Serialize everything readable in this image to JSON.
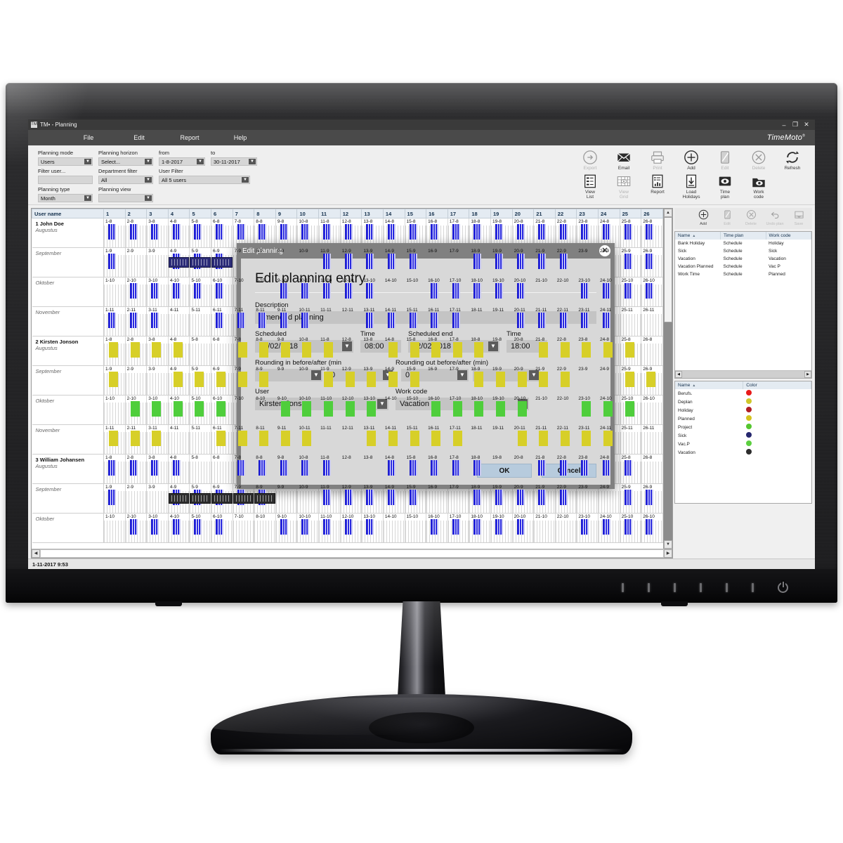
{
  "window": {
    "title": "TM• - Planning",
    "app_icon": "TM",
    "minimize": "–",
    "maximize": "❐",
    "close": "✕",
    "brand": "TimeMoto",
    "brand_mark": "®"
  },
  "menubar": {
    "items": [
      "File",
      "Edit",
      "Report",
      "Help"
    ]
  },
  "filters": {
    "planning_mode": {
      "label": "Planning mode",
      "value": "Users"
    },
    "planning_horizon": {
      "label": "Planning horizon",
      "value": "Select..."
    },
    "from": {
      "label": "from",
      "value": "1-8-2017"
    },
    "to": {
      "label": "to",
      "value": "30-11-2017"
    },
    "filter_user": {
      "label": "Filter user...",
      "value": ""
    },
    "department_filter": {
      "label": "Department filter",
      "value": "All"
    },
    "user_filter": {
      "label": "User Filter",
      "value": "All 5 users"
    },
    "planning_type": {
      "label": "Planning type",
      "value": "Month"
    },
    "planning_view": {
      "label": "Planning view",
      "value": ""
    }
  },
  "toolbar": {
    "row1": [
      {
        "label": "Export",
        "icon": "export-icon",
        "disabled": true
      },
      {
        "label": "Email",
        "icon": "email-icon",
        "disabled": false
      },
      {
        "label": "Print",
        "icon": "print-icon",
        "disabled": true
      },
      {
        "label": "Add",
        "icon": "add-icon",
        "disabled": false
      },
      {
        "label": "Edit",
        "icon": "edit-icon",
        "disabled": true
      },
      {
        "label": "Delete",
        "icon": "delete-icon",
        "disabled": true
      },
      {
        "label": "Refresh",
        "icon": "refresh-icon",
        "disabled": false
      }
    ],
    "row2": [
      {
        "label": "View List",
        "icon": "view-list-icon",
        "disabled": false
      },
      {
        "label": "View Grid",
        "icon": "view-grid-icon",
        "disabled": true
      },
      {
        "label": "Report",
        "icon": "report-icon",
        "disabled": false
      },
      {
        "label": "Load Holidays",
        "icon": "load-holidays-icon",
        "disabled": false
      },
      {
        "label": "Time plan",
        "icon": "time-plan-icon",
        "disabled": false
      },
      {
        "label": "Work code",
        "icon": "work-code-icon",
        "disabled": false
      }
    ]
  },
  "grid": {
    "user_col_header": "User name",
    "day_headers": [
      "1",
      "2",
      "3",
      "4",
      "5",
      "6",
      "7",
      "8",
      "9",
      "10",
      "11",
      "12",
      "13",
      "14",
      "15",
      "16",
      "17",
      "18",
      "19",
      "20",
      "21",
      "22",
      "23",
      "24",
      "25",
      "26"
    ],
    "rows": [
      {
        "name": "1 John Doe",
        "month": "Augustus",
        "suffix": "-8",
        "bar": "work",
        "bar_days": [
          1,
          2,
          3,
          4,
          5,
          6,
          7,
          8,
          9,
          10,
          11,
          12,
          13,
          14,
          15,
          16,
          17,
          18,
          19,
          20,
          21,
          22,
          23,
          24,
          25,
          26
        ],
        "overlay": null,
        "overlay_days": []
      },
      {
        "name": "",
        "month": "September",
        "suffix": "-9",
        "bar": "work",
        "bar_days": [
          1,
          4,
          5,
          6,
          11,
          12,
          13,
          14,
          15,
          18,
          19,
          20,
          21,
          22,
          25,
          26
        ],
        "overlay": "select",
        "overlay_days": [
          4,
          5,
          6
        ]
      },
      {
        "name": "",
        "month": "Oktober",
        "suffix": "-10",
        "bar": "work",
        "bar_days": [
          2,
          3,
          4,
          5,
          6,
          9,
          10,
          11,
          12,
          13,
          16,
          17,
          18,
          19,
          20,
          23,
          24,
          25,
          26
        ],
        "overlay": null,
        "overlay_days": []
      },
      {
        "name": "",
        "month": "November",
        "suffix": "-11",
        "bar": "work",
        "bar_days": [
          1,
          2,
          3,
          6,
          7,
          8,
          9,
          10,
          13,
          14,
          15,
          16,
          17,
          20,
          21,
          22,
          23,
          24
        ],
        "overlay": null,
        "overlay_days": []
      },
      {
        "name": "2 Kirsten Jonson",
        "month": "Augustus",
        "suffix": "-8",
        "bar": "yellow",
        "bar_days": [
          1,
          2,
          3,
          4,
          7,
          8,
          9,
          10,
          11,
          14,
          15,
          16,
          17,
          18,
          21,
          22,
          23,
          24,
          25
        ],
        "overlay": null,
        "overlay_days": []
      },
      {
        "name": "",
        "month": "September",
        "suffix": "-9",
        "bar": "yellow",
        "bar_days": [
          1,
          4,
          5,
          6,
          7,
          8,
          11,
          12,
          13,
          14,
          15,
          18,
          19,
          20,
          21,
          22,
          25,
          26
        ],
        "overlay": null,
        "overlay_days": []
      },
      {
        "name": "",
        "month": "Oktober",
        "suffix": "-10",
        "bar": "green",
        "bar_days": [
          2,
          3,
          4,
          5,
          6,
          9,
          10,
          11,
          12,
          13,
          16,
          17,
          18,
          19,
          20,
          23,
          24,
          25
        ],
        "overlay": null,
        "overlay_days": []
      },
      {
        "name": "",
        "month": "November",
        "suffix": "-11",
        "bar": "yellow",
        "bar_days": [
          1,
          2,
          3,
          6,
          7,
          8,
          9,
          10,
          13,
          14,
          15,
          16,
          17,
          20,
          21,
          22,
          23,
          24
        ],
        "overlay": null,
        "overlay_days": []
      },
      {
        "name": "3 William Johansen",
        "month": "Augustus",
        "suffix": "-8",
        "bar": "work",
        "bar_days": [
          1,
          2,
          3,
          4,
          7,
          8,
          9,
          10,
          11,
          14,
          15,
          16,
          17,
          18,
          21,
          22,
          23,
          24,
          25
        ],
        "overlay": null,
        "overlay_days": []
      },
      {
        "name": "",
        "month": "September",
        "suffix": "-9",
        "bar": "work",
        "bar_days": [
          1,
          4,
          5,
          6,
          7,
          8,
          11,
          12,
          13,
          14,
          15,
          18,
          19,
          20,
          21,
          22,
          25,
          26
        ],
        "overlay": "dark",
        "overlay_days": [
          4,
          5,
          6,
          7,
          8
        ]
      },
      {
        "name": "",
        "month": "Oktober",
        "suffix": "-10",
        "bar": "work",
        "bar_days": [
          2,
          3,
          4,
          5,
          6,
          9,
          10,
          11,
          12,
          13,
          16,
          17,
          18,
          19,
          20,
          23,
          24,
          25,
          26
        ],
        "overlay": null,
        "overlay_days": []
      }
    ]
  },
  "right_panel": {
    "toolbar": [
      {
        "label": "Add",
        "icon": "add-icon",
        "disabled": false
      },
      {
        "label": "Edit",
        "icon": "edit-icon",
        "disabled": true
      },
      {
        "label": "Delete",
        "icon": "delete-icon",
        "disabled": true
      },
      {
        "label": "Undo plan",
        "icon": "undo-icon",
        "disabled": true
      },
      {
        "label": "Save",
        "icon": "save-icon",
        "disabled": true
      }
    ],
    "timeplan": {
      "columns": [
        "Name",
        "Time plan",
        "Work code"
      ],
      "sorted_column": "Name",
      "sort_caret": "▲",
      "rows": [
        [
          "Bank Holiday",
          "Schedule",
          "Holiday"
        ],
        [
          "Sick",
          "Schedule",
          "Sick"
        ],
        [
          "Vacation",
          "Schedule",
          "Vacation"
        ],
        [
          "Vacation Planned",
          "Schedule",
          "Vac P"
        ],
        [
          "Work Time",
          "Schedule",
          "Planned"
        ]
      ]
    },
    "workcode": {
      "columns": [
        "Name",
        "Color"
      ],
      "sorted_column": "Name",
      "sort_caret": "▲",
      "rows": [
        {
          "name": "Berufs.",
          "color": "#e81a1a"
        },
        {
          "name": "Deplan",
          "color": "#cfc72a"
        },
        {
          "name": "Holiday",
          "color": "#b01d24"
        },
        {
          "name": "Planned",
          "color": "#d4c31f"
        },
        {
          "name": "Project",
          "color": "#55c62f"
        },
        {
          "name": "Sick",
          "color": "#26276e"
        },
        {
          "name": "Vac.P",
          "color": "#5ccf3f"
        },
        {
          "name": "Vacation",
          "color": "#2d2d2d"
        }
      ]
    }
  },
  "statusbar": {
    "text": "1-11-2017 9:53"
  },
  "modal": {
    "titlebar": "Edit planning",
    "close_glyph": "✕",
    "heading": "Edit planning entry",
    "description_label": "Description",
    "description_value": "Amended planning",
    "scheduled_label": "Scheduled",
    "scheduled_value": "12/02/2018",
    "scheduled_time_label": "Time",
    "scheduled_time_value": "08:00",
    "scheduled_end_label": "Scheduled end",
    "scheduled_end_value": "12/02/2018",
    "scheduled_end_time_label": "Time",
    "scheduled_end_time_value": "18:00",
    "rounding_in_label": "Rounding in before/after (min",
    "rounding_in_before": "0",
    "rounding_in_after": "0",
    "rounding_out_label": "Rounding out before/after (min)",
    "rounding_out_before": "0",
    "rounding_out_after": "0",
    "user_label": "User",
    "user_value": "Kirsten Jonson",
    "workcode_label": "Work code",
    "workcode_value": "Vacation",
    "ok_label": "OK",
    "cancel_label": "Cancel",
    "dropdown_glyph": "▼"
  },
  "monitor": {
    "power_icon": "power-icon"
  }
}
